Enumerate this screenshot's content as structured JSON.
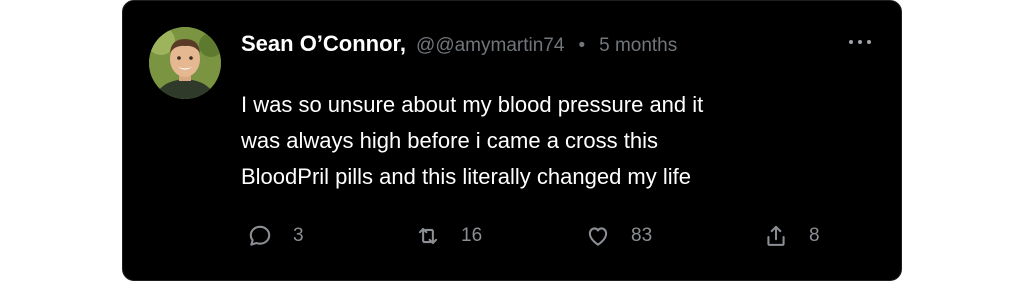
{
  "tweet": {
    "author_name": "Sean O’Connor,",
    "handle": "@@amymartin74",
    "separator": "•",
    "timestamp": "5 months",
    "text_lines": [
      "I was so unsure about my blood pressure and it",
      "was always high before i came a cross this",
      "BloodPril pills and this literally changed my life"
    ],
    "actions": {
      "reply": {
        "icon": "reply-bubble-icon",
        "count": "3"
      },
      "retweet": {
        "icon": "retweet-icon",
        "count": "16"
      },
      "like": {
        "icon": "heart-icon",
        "count": "83"
      },
      "share": {
        "icon": "share-icon",
        "count": "8"
      }
    }
  },
  "colors": {
    "card_background": "#000000",
    "page_background": "#ffffff",
    "muted_text": "#71767b",
    "primary_text": "#ffffff"
  }
}
